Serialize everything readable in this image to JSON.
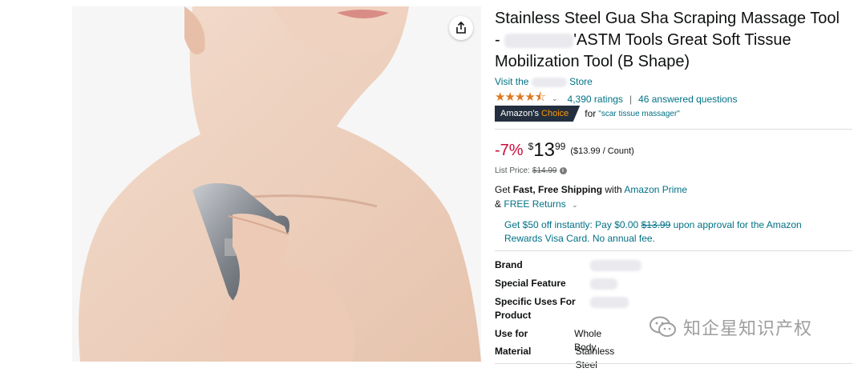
{
  "product": {
    "title_line1": "Stainless Steel Gua Sha Scraping Massage Tool",
    "title_line2_prefix": "-",
    "title_line2_suffix": "'ASTM Tools Great Soft Tissue",
    "title_line3": "Mobilization Tool (B Shape)",
    "store_prefix": "Visit the",
    "store_suffix": "Store"
  },
  "rating": {
    "stars_value": 4.5,
    "stars_glyphs": "★★★★⯪",
    "ratings_text": "4,390 ratings",
    "separator": "|",
    "questions_text": "46 answered questions"
  },
  "badge": {
    "label_prefix": "Amazon's",
    "label_choice": "Choice",
    "for_text": "for",
    "query": "\"scar tissue massager\""
  },
  "price": {
    "discount": "-7%",
    "currency": "$",
    "whole": "13",
    "fraction": "99",
    "per_unit": "($13.99 / Count)",
    "list_label": "List Price:",
    "list_value": "$14.99"
  },
  "shipping": {
    "get": "Get",
    "fast_free": "Fast, Free Shipping",
    "with": "with",
    "prime_link": "Amazon Prime",
    "amp": "&",
    "returns_link": "FREE Returns"
  },
  "promo": {
    "text_a": "Get $50 off instantly: Pay $0.00",
    "strike": "$13.99",
    "text_b": "upon approval for the Amazon Rewards Visa Card. No annual fee."
  },
  "specs": [
    {
      "label": "Brand",
      "value": ""
    },
    {
      "label": "Special Feature",
      "value": ""
    },
    {
      "label": "Specific Uses For Product",
      "value": ""
    },
    {
      "label": "Use for",
      "value": "Whole Body"
    },
    {
      "label": "Material",
      "value": "Stainless Steel"
    }
  ],
  "watermark": {
    "text": "知企星知识产权"
  },
  "colors": {
    "link": "#007185",
    "star": "#de7921",
    "discount": "#cc0c39",
    "badge_bg": "#232f3e",
    "badge_choice": "#ff9900"
  },
  "icons": {
    "share": "share-icon",
    "info": "info-icon",
    "chevron": "chevron-down-icon",
    "watermark": "wechat-icon"
  }
}
